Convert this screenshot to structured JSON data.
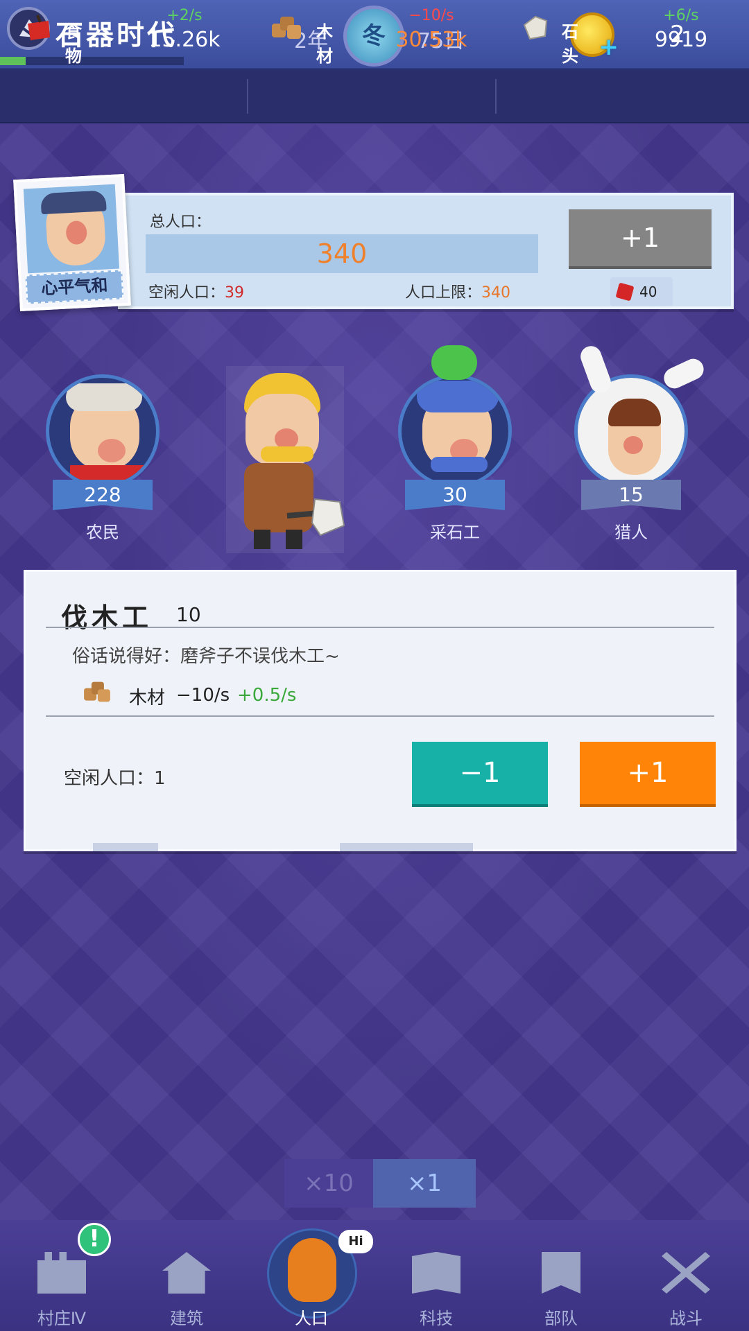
{
  "header": {
    "game_title": "石器时代",
    "year": "2年",
    "season": "冬",
    "day": "75日",
    "gold_count": "2",
    "progress_fraction": 0.14
  },
  "resources": [
    {
      "name": "食物",
      "rate": "+2/s",
      "amount": "15.26k",
      "rate_color": "#5fd35f",
      "amount_color": "#ffffff"
    },
    {
      "name": "木材",
      "rate": "−10/s",
      "amount": "30.53k",
      "rate_color": "#ff4a4a",
      "amount_color": "#ff8a3a"
    },
    {
      "name": "石头",
      "rate": "+6/s",
      "amount": "9919",
      "rate_color": "#5fd35f",
      "amount_color": "#ffffff"
    }
  ],
  "population": {
    "mood": "心平气和",
    "total_label": "总人口：",
    "total": "340",
    "idle_label": "空闲人口：",
    "idle": "39",
    "cap_label": "人口上限：",
    "cap": "340",
    "add_button": "+1",
    "add_cost": "40"
  },
  "characters": [
    {
      "name": "农民",
      "count": "228"
    },
    {
      "name": "伐木工",
      "count": "10",
      "selected": true
    },
    {
      "name": "采石工",
      "count": "30"
    },
    {
      "name": "猎人",
      "count": "15"
    }
  ],
  "detail": {
    "title": "伐木工",
    "count": "10",
    "description": "俗话说得好：磨斧子不误伐木工~",
    "resource": "木材",
    "rate": "−10/s",
    "bonus": "+0.5/s",
    "idle_text": "空闲人口：1",
    "minus_button": "−1",
    "plus_button": "+1"
  },
  "multiplier": {
    "x10": "×10",
    "x1": "×1",
    "selected": "x1"
  },
  "nav": [
    {
      "label": "村庄Ⅳ",
      "icon": "castle-icon",
      "badge": "!"
    },
    {
      "label": "建筑",
      "icon": "house-icon"
    },
    {
      "label": "人口",
      "icon": "mascot-icon",
      "bubble": "Hi",
      "selected": true
    },
    {
      "label": "科技",
      "icon": "book-icon"
    },
    {
      "label": "部队",
      "icon": "banner-icon"
    },
    {
      "label": "战斗",
      "icon": "crossed-swords-icon"
    }
  ]
}
